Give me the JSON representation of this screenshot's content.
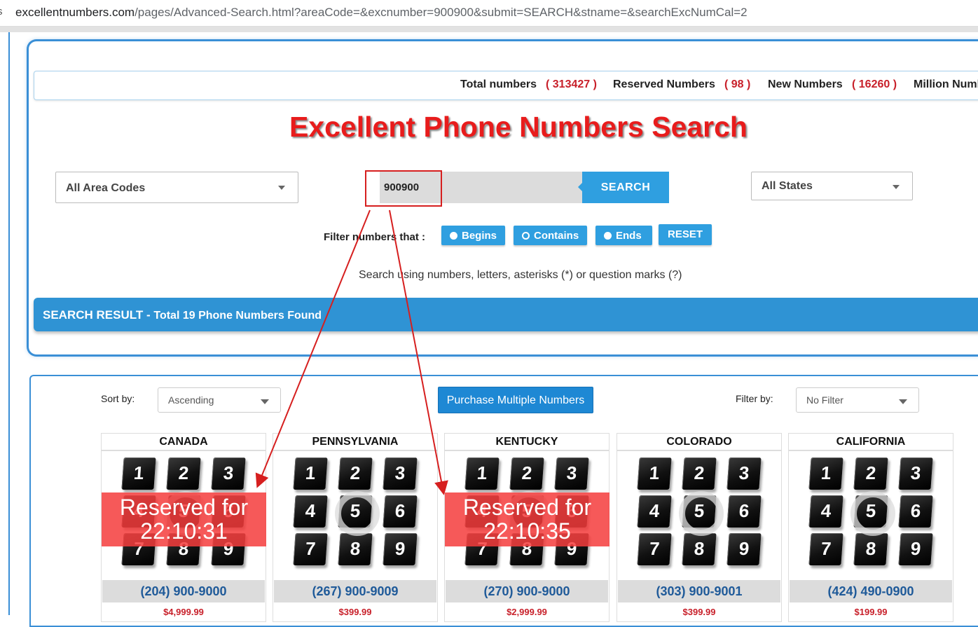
{
  "browser": {
    "secure_glyph": "s",
    "url_domain": "excellentnumbers.com",
    "url_path": "/pages/Advanced-Search.html?areaCode=&excnumber=900900&submit=SEARCH&stname=&searchExcNumCal=2"
  },
  "stats": [
    {
      "label": "Total numbers",
      "value": "( 313427 )"
    },
    {
      "label": "Reserved Numbers",
      "value": "( 98 )"
    },
    {
      "label": "New Numbers",
      "value": "( 16260 )"
    },
    {
      "label": "Million Numb",
      "value": ""
    }
  ],
  "title": "Excellent Phone Numbers Search",
  "area_select": {
    "value": "All Area Codes"
  },
  "search": {
    "value": "900900",
    "button": "SEARCH"
  },
  "states_select": {
    "value": "All States"
  },
  "filter": {
    "label": "Filter numbers that :",
    "options": [
      {
        "label": "Begins",
        "selected": false
      },
      {
        "label": "Contains",
        "selected": true
      },
      {
        "label": "Ends",
        "selected": false
      }
    ],
    "reset": "RESET"
  },
  "hint": "Search using numbers, letters, asterisks (*) or question marks (?)",
  "result_bar": {
    "prefix": "SEARCH RESULT - ",
    "text": "Total 19 Phone Numbers Found"
  },
  "toolbar": {
    "sort_label": "Sort by:",
    "sort_value": "Ascending",
    "purchase": "Purchase Multiple Numbers",
    "filter_label": "Filter by:",
    "filter_value": "No Filter"
  },
  "keypad": [
    "1",
    "2",
    "3",
    "4",
    "5",
    "6",
    "7",
    "8",
    "9"
  ],
  "cards": [
    {
      "state": "CANADA",
      "phone": "(204) 900-9000",
      "price": "$4,999.99",
      "reserved": true,
      "reserved_label": "Reserved for",
      "timer": "22:10:31"
    },
    {
      "state": "PENNSYLVANIA",
      "phone": "(267) 900-9009",
      "price": "$399.99",
      "reserved": false
    },
    {
      "state": "KENTUCKY",
      "phone": "(270) 900-9000",
      "price": "$2,999.99",
      "reserved": true,
      "reserved_label": "Reserved for",
      "timer": "22:10:35"
    },
    {
      "state": "COLORADO",
      "phone": "(303) 900-9001",
      "price": "$399.99",
      "reserved": false
    },
    {
      "state": "CALIFORNIA",
      "phone": "(424) 490-0900",
      "price": "$199.99",
      "reserved": false
    }
  ],
  "colors": {
    "accent": "#2f9fe0",
    "title_red": "#e81c1c",
    "annotation_red": "#d61f1f"
  }
}
